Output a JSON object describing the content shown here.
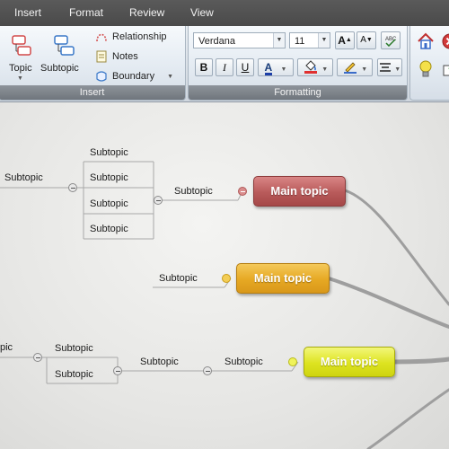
{
  "menu": {
    "items": [
      "Insert",
      "Format",
      "Review",
      "View"
    ]
  },
  "ribbon": {
    "insert_group": {
      "label": "Insert",
      "topic_label": "Topic",
      "subtopic_label": "Subtopic",
      "relationship_label": "Relationship",
      "notes_label": "Notes",
      "boundary_label": "Boundary"
    },
    "formatting_group": {
      "label": "Formatting",
      "font_family": "Verdana",
      "font_size": "11",
      "bold": "B",
      "italic": "I",
      "underline": "U",
      "font_color_glyph": "A",
      "grow_font": "A",
      "shrink_font": "A"
    }
  },
  "canvas": {
    "main_topics": [
      "Main topic",
      "Main topic",
      "Main topic"
    ],
    "subtopics_top": [
      "Subtopic",
      "Subtopic",
      "Subtopic",
      "Subtopic",
      "Subtopic",
      "Subtopic",
      "Subtopic"
    ],
    "subtopics_mid": [
      "Subtopic"
    ],
    "subtopics_bottom": [
      "pic",
      "Subtopic",
      "Subtopic",
      "Subtopic",
      "Subtopic"
    ]
  },
  "colors": {
    "main_topic_red": "#b85a5a",
    "main_topic_orange": "#e6a823",
    "main_topic_yellow": "#dde320",
    "menubar": "#4f4f4f"
  }
}
